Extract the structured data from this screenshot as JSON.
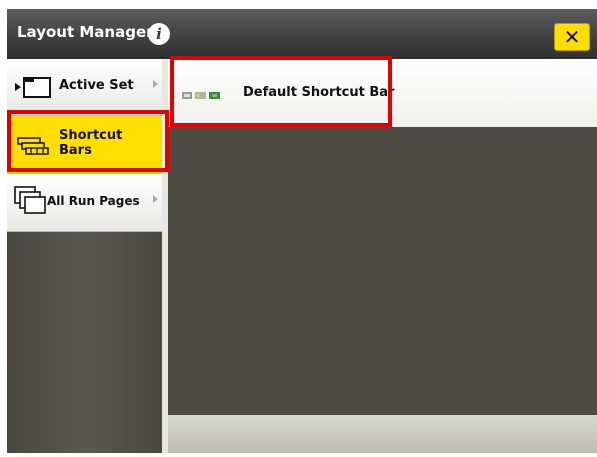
{
  "window": {
    "title": "Layout Manager",
    "info_glyph": "i",
    "close_glyph": "✕",
    "colors": {
      "accent": "#ffde00",
      "highlight": "#e40000",
      "background": "#4d4a42"
    }
  },
  "sidebar": {
    "items": [
      {
        "label": "Active Set",
        "icon": "active-set-icon",
        "active": false
      },
      {
        "label": "Shortcut\nBars",
        "icon": "shortcut-bars-icon",
        "active": true
      },
      {
        "label": "All Run Pages",
        "icon": "run-pages-icon",
        "active": false
      }
    ]
  },
  "content": {
    "items": [
      {
        "label": "Default Shortcut Bar",
        "icon": "shortcut-bar-preview-icon"
      }
    ]
  }
}
